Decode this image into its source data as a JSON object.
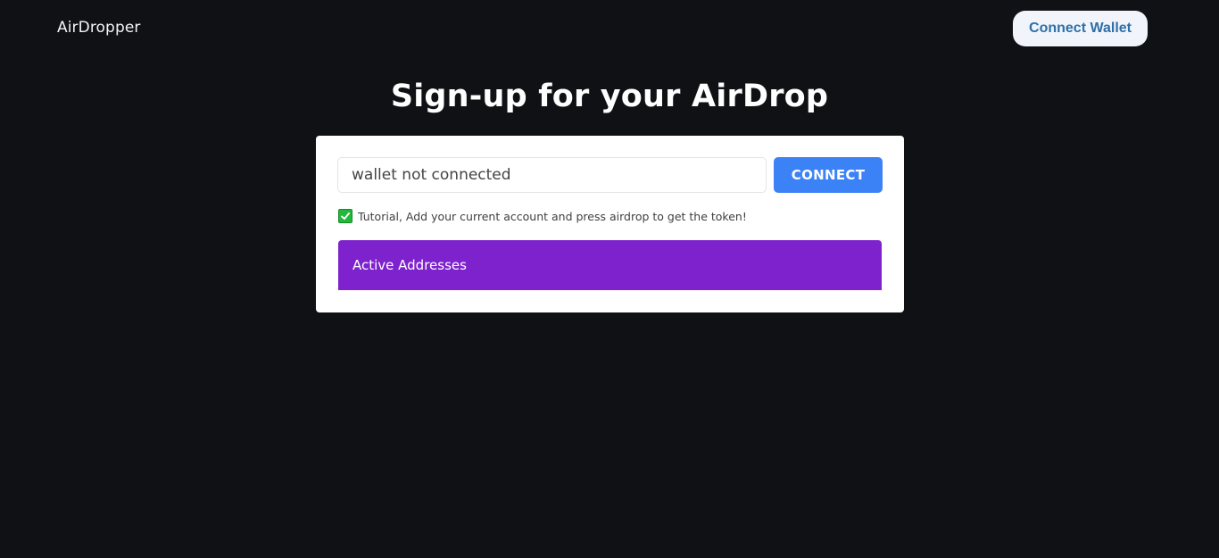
{
  "header": {
    "brand": "AirDropper",
    "connect_wallet_label": "Connect Wallet"
  },
  "main": {
    "title": "Sign-up for your AirDrop",
    "wallet_input_value": "wallet not connected",
    "connect_label": "CONNECT",
    "tutorial_text": "Tutorial, Add your current account and press airdrop to get the token!",
    "active_addresses_label": "Active Addresses"
  },
  "icons": {
    "tutorial_check": "check-mark-icon"
  },
  "colors": {
    "background": "#0f1115",
    "connect_button": "#3b82f6",
    "active_panel": "#7e22ce",
    "wallet_button_text": "#2f6fa8",
    "check_icon": "#22b83a"
  }
}
